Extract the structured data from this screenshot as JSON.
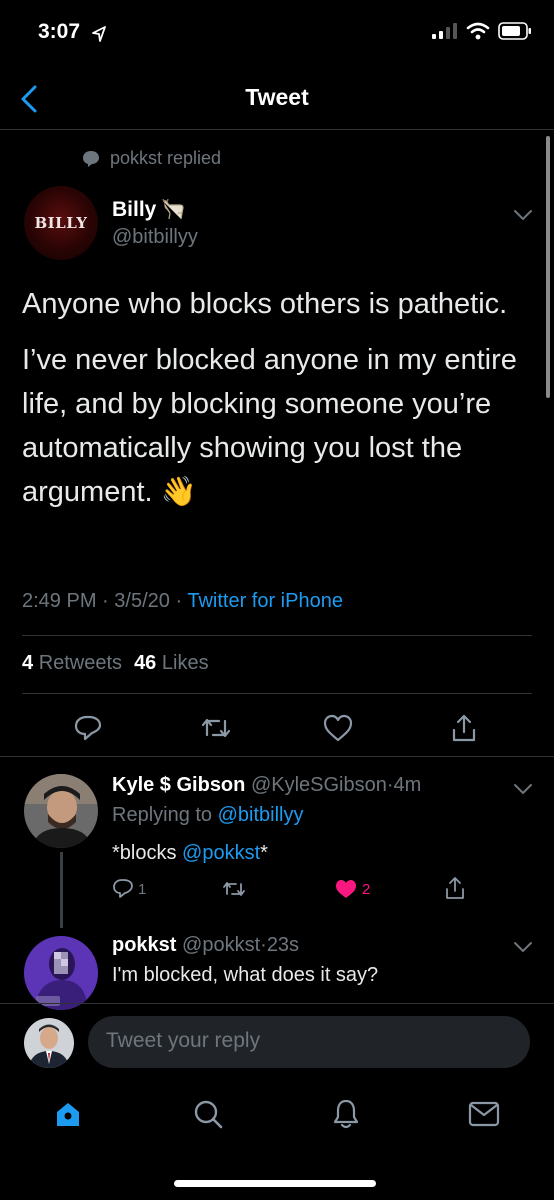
{
  "status_bar": {
    "time": "3:07"
  },
  "nav": {
    "title": "Tweet"
  },
  "tweet": {
    "context": "pokkst replied",
    "avatar_text": "BILLY",
    "author_name": "Billy",
    "author_handle": "@bitbillyy",
    "paragraph_1": "Anyone who blocks others is pathetic.",
    "paragraph_2": "I’ve never blocked anyone in my entire life, and by blocking someone you’re automatically showing you lost the argument.",
    "emoji": "👋",
    "time": "2:49 PM",
    "date": "3/5/20",
    "sep": "·",
    "source": "Twitter for iPhone",
    "retweets_count": "4",
    "retweets_label": "Retweets",
    "likes_count": "46",
    "likes_label": "Likes"
  },
  "replies": [
    {
      "name": "Kyle $ Gibson",
      "handle": "@KyleSGibson",
      "age": "4m",
      "replying_prefix": "Replying to",
      "replying_handle": "@bitbillyy",
      "body_prefix": "*blocks",
      "body_mention": "@pokkst",
      "body_suffix": "*",
      "reply_count": "1",
      "like_count": "2"
    },
    {
      "name": "pokkst",
      "handle": "@pokkst",
      "age": "23s",
      "body": "I'm blocked, what does it say?"
    }
  ],
  "composer": {
    "placeholder": "Tweet your reply"
  },
  "colors": {
    "accent": "#1d9bf0",
    "liked": "#f91880",
    "background": "#000000"
  }
}
